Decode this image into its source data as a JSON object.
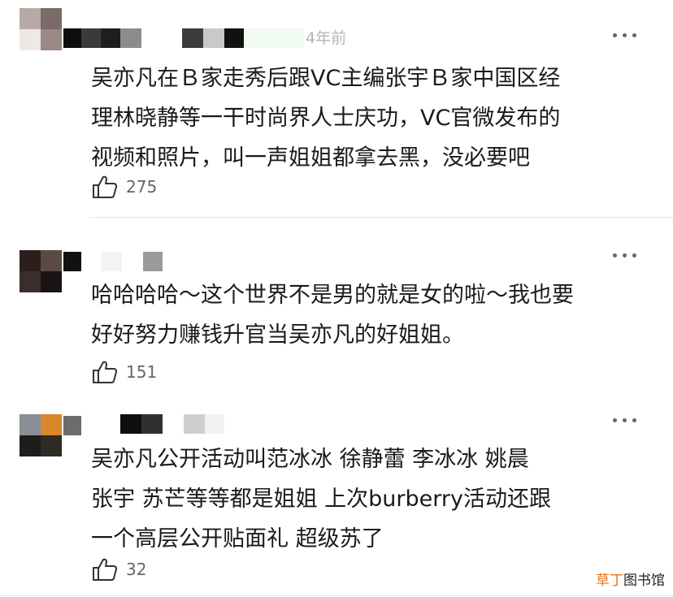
{
  "comments": [
    {
      "time": "4年前",
      "lines": [
        "吴亦凡在Ｂ家走秀后跟VC主编张宇Ｂ家中国区经",
        "理林晓静等一干时尚界人士庆功，VC官微发布的",
        "视频和照片，叫一声姐姐都拿去黑，没必要吧"
      ],
      "likes": "275",
      "like_icon": "thumbs-up-icon",
      "more_icon": "more-icon"
    },
    {
      "time": "",
      "lines": [
        "哈哈哈哈～这个世界不是男的就是女的啦～我也要",
        "好好努力赚钱升官当吴亦凡的好姐姐。"
      ],
      "likes": "151",
      "like_icon": "thumbs-up-icon",
      "more_icon": "more-icon"
    },
    {
      "time": "",
      "lines": [
        "吴亦凡公开活动叫范冰冰  徐静蕾   李冰冰   姚晨",
        "张宇    苏芒等等都是姐姐   上次burberry活动还跟",
        "一个高层公开贴面礼   超级苏了"
      ],
      "likes": "32",
      "like_icon": "thumbs-up-icon",
      "more_icon": "more-icon"
    }
  ],
  "watermark": {
    "part1": "草丁",
    "part2": "图书馆"
  },
  "colors": {
    "text": "#1a1a1a",
    "meta": "#666666",
    "time": "#b4b4b4",
    "watermark_accent": "#e8731a"
  }
}
